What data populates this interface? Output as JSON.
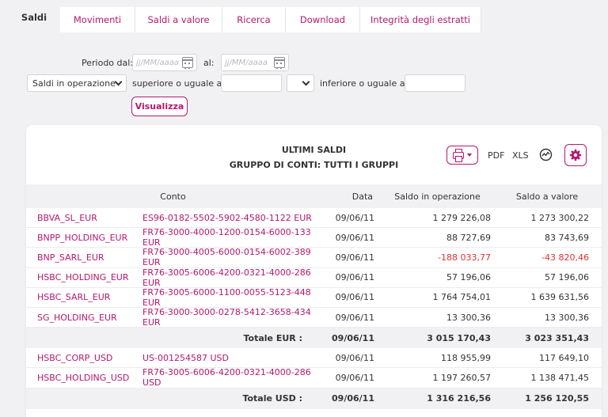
{
  "tabs": [
    {
      "label": "Saldi",
      "active": true
    },
    {
      "label": "Movimenti",
      "active": false
    },
    {
      "label": "Saldi a valore",
      "active": false
    },
    {
      "label": "Ricerca",
      "active": false
    },
    {
      "label": "Download",
      "active": false
    },
    {
      "label": "Integrità degli estratti",
      "active": false
    }
  ],
  "filters": {
    "periodo_dal_label": "Periodo dal:",
    "date_from_placeholder": "jj/MM/aaaa",
    "al_label": "al:",
    "date_to_placeholder": "jj/MM/aaaa",
    "select_type_value": "Saldi in operazione",
    "superiore_label": "superiore o uguale a:",
    "superiore_value": "",
    "operator_value": "",
    "inferiore_label": "inferiore o uguale a:",
    "inferiore_value": "",
    "submit_label": "Visualizza"
  },
  "card": {
    "title_line1": "ULTIMI SALDI",
    "title_line2": "GRUPPO DI CONTI: TUTTI I GRUPPI",
    "pdf_label": "PDF",
    "xls_label": "XLS"
  },
  "table": {
    "headers": {
      "conto": "Conto",
      "data": "Data",
      "saldo_op": "Saldo in operazione",
      "saldo_val": "Saldo a valore"
    },
    "groups": [
      {
        "rows": [
          {
            "name": "BBVA_SL_EUR",
            "conto": "ES96-0182-5502-5902-4580-1122 EUR",
            "data": "09/06/11",
            "op": "1 279 226,08",
            "val": "1 273 300,22"
          },
          {
            "name": "BNPP_HOLDING_EUR",
            "conto": "FR76-3000-4000-1200-0154-6000-133 EUR",
            "data": "09/06/11",
            "op": "88 727,69",
            "val": "83 743,69"
          },
          {
            "name": "BNP_SARL_EUR",
            "conto": "FR76-3000-4005-6000-0154-6002-389 EUR",
            "data": "09/06/11",
            "op": "-188 033,77",
            "val": "-43 820,46"
          },
          {
            "name": "HSBC_HOLDING_EUR",
            "conto": "FR76-3005-6006-4200-0321-4000-286 EUR",
            "data": "09/06/11",
            "op": "57 196,06",
            "val": "57 196,06"
          },
          {
            "name": "HSBC_SARL_EUR",
            "conto": "FR76-3005-6000-1100-0055-5123-448 EUR",
            "data": "09/06/11",
            "op": "1 764 754,01",
            "val": "1 639 631,56"
          },
          {
            "name": "SG_HOLDING_EUR",
            "conto": "FR76-3000-3000-0278-5412-3658-434 EUR",
            "data": "09/06/11",
            "op": "13 300,36",
            "val": "13 300,36"
          }
        ],
        "total": {
          "label": "Totale EUR :",
          "data": "09/06/11",
          "op": "3 015 170,43",
          "val": "3 023 351,43"
        }
      },
      {
        "rows": [
          {
            "name": "HSBC_CORP_USD",
            "conto": "US-001254587 USD",
            "data": "09/06/11",
            "op": "118 955,99",
            "val": "117 649,10"
          },
          {
            "name": "HSBC_HOLDING_USD",
            "conto": "FR76-3005-6006-4200-0321-4000-286 USD",
            "data": "09/06/11",
            "op": "1 197 260,57",
            "val": "1 138 471,45"
          }
        ],
        "total": {
          "label": "Totale USD :",
          "data": "09/06/11",
          "op": "1 316 216,56",
          "val": "1 256 120,55"
        }
      }
    ]
  },
  "colors": {
    "accent": "#b5186e",
    "negative": "#e0322f",
    "background": "#f1f1f3"
  }
}
